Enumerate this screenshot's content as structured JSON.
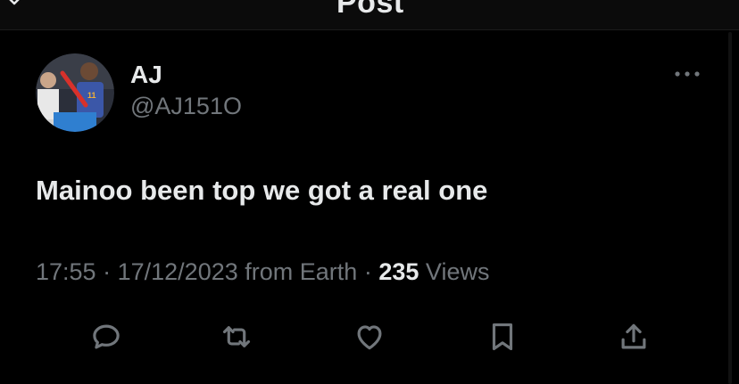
{
  "header": {
    "title": "Post"
  },
  "author": {
    "name": "AJ",
    "handle": "@AJ151O"
  },
  "tweet": {
    "text": "Mainoo been top we got a real one"
  },
  "meta": {
    "time": "17:55",
    "date": "17/12/2023",
    "source": "from Earth",
    "views_count": "235",
    "views_label": "Views",
    "separator": "·"
  },
  "icons": {
    "back": "back-arrow-icon",
    "more": "more-dots-icon",
    "reply": "reply-icon",
    "repost": "repost-icon",
    "like": "heart-icon",
    "bookmark": "bookmark-icon",
    "share": "share-icon"
  },
  "colors": {
    "background": "#000000",
    "primary_text": "#e7e9ea",
    "secondary_text": "#71767b"
  }
}
